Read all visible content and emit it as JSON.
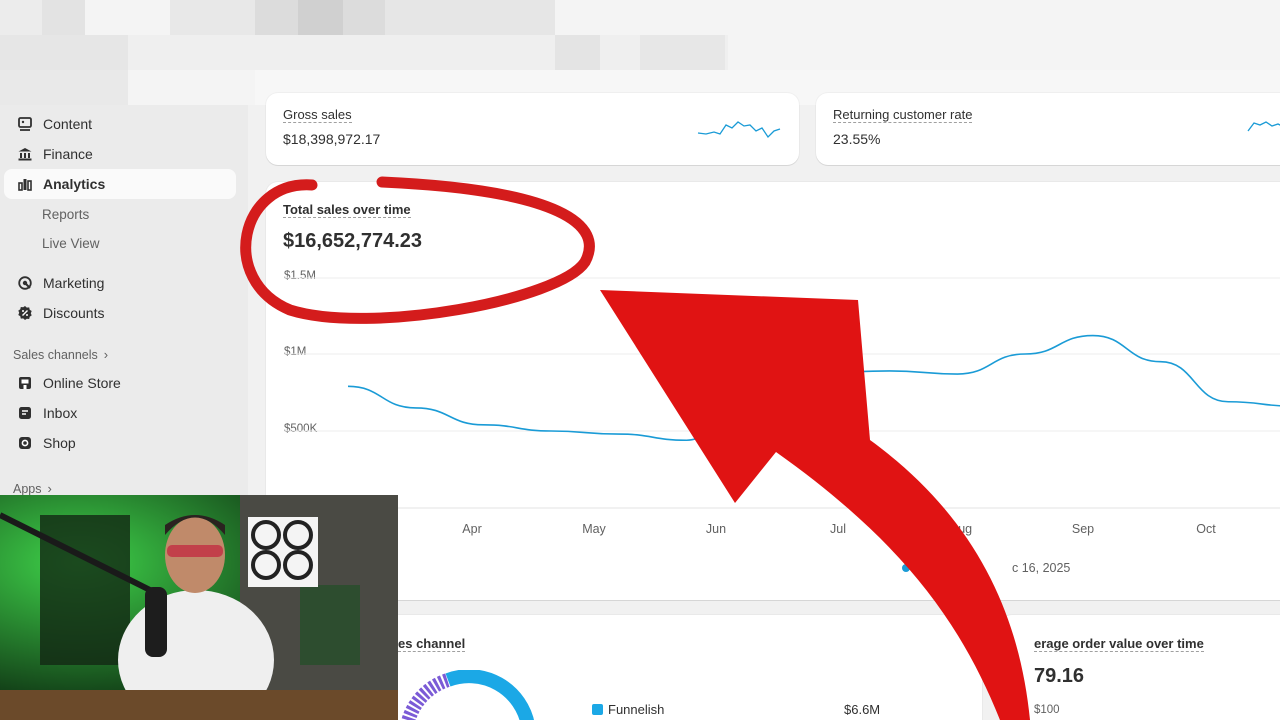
{
  "sidebar": {
    "items": [
      {
        "label": "Content",
        "icon": "content-icon"
      },
      {
        "label": "Finance",
        "icon": "bank-icon"
      },
      {
        "label": "Analytics",
        "icon": "bar-chart-icon",
        "active": true
      },
      {
        "label": "Marketing",
        "icon": "target-icon"
      },
      {
        "label": "Discounts",
        "icon": "discount-icon"
      },
      {
        "label": "Online Store",
        "icon": "storefront-icon"
      },
      {
        "label": "Inbox",
        "icon": "inbox-icon"
      },
      {
        "label": "Shop",
        "icon": "shop-icon"
      }
    ],
    "subitems": [
      "Reports",
      "Live View"
    ],
    "sections": {
      "sales_channels": "Sales channels",
      "apps": "Apps"
    }
  },
  "metrics": {
    "gross_sales": {
      "label": "Gross sales",
      "value": "$18,398,972.17"
    },
    "returning_rate": {
      "label": "Returning customer rate",
      "value": "23.55%"
    }
  },
  "total_sales": {
    "title": "Total sales over time",
    "value": "$16,652,774.23",
    "legend_a": "Ma",
    "legend_b": "c 16, 2025"
  },
  "sales_by_channel": {
    "title_fragment": "es channel",
    "row_label": "Funnelish",
    "row_value": "$6.6M"
  },
  "aov": {
    "title_fragment": "erage order value over time",
    "value_fragment": "79.16",
    "ytick": "$100"
  },
  "colors": {
    "line": "#1a9bd6",
    "annotation": "#d91d1d",
    "card": "#ffffff",
    "sidebar": "#ebebeb"
  },
  "chart_data": {
    "type": "line",
    "yticks": [
      "$1.5M",
      "$1M",
      "$500K"
    ],
    "xticks": [
      "Apr",
      "May",
      "Jun",
      "Jul",
      "Aug",
      "Sep",
      "Oct"
    ],
    "ylim": [
      0,
      1500000
    ],
    "x": [
      "Mar 16",
      "Apr 1",
      "Apr 15",
      "May 1",
      "May 15",
      "Jun 1",
      "Jun 15",
      "Jul 1",
      "Jul 15",
      "Aug 1",
      "Aug 15",
      "Sep 1",
      "Sep 15",
      "Oct 1",
      "Oct 15"
    ],
    "series": [
      {
        "values": [
          790000,
          650000,
          540000,
          500000,
          480000,
          440000,
          760000,
          880000,
          890000,
          870000,
          1000000,
          1120000,
          950000,
          690000,
          660000
        ]
      }
    ]
  }
}
